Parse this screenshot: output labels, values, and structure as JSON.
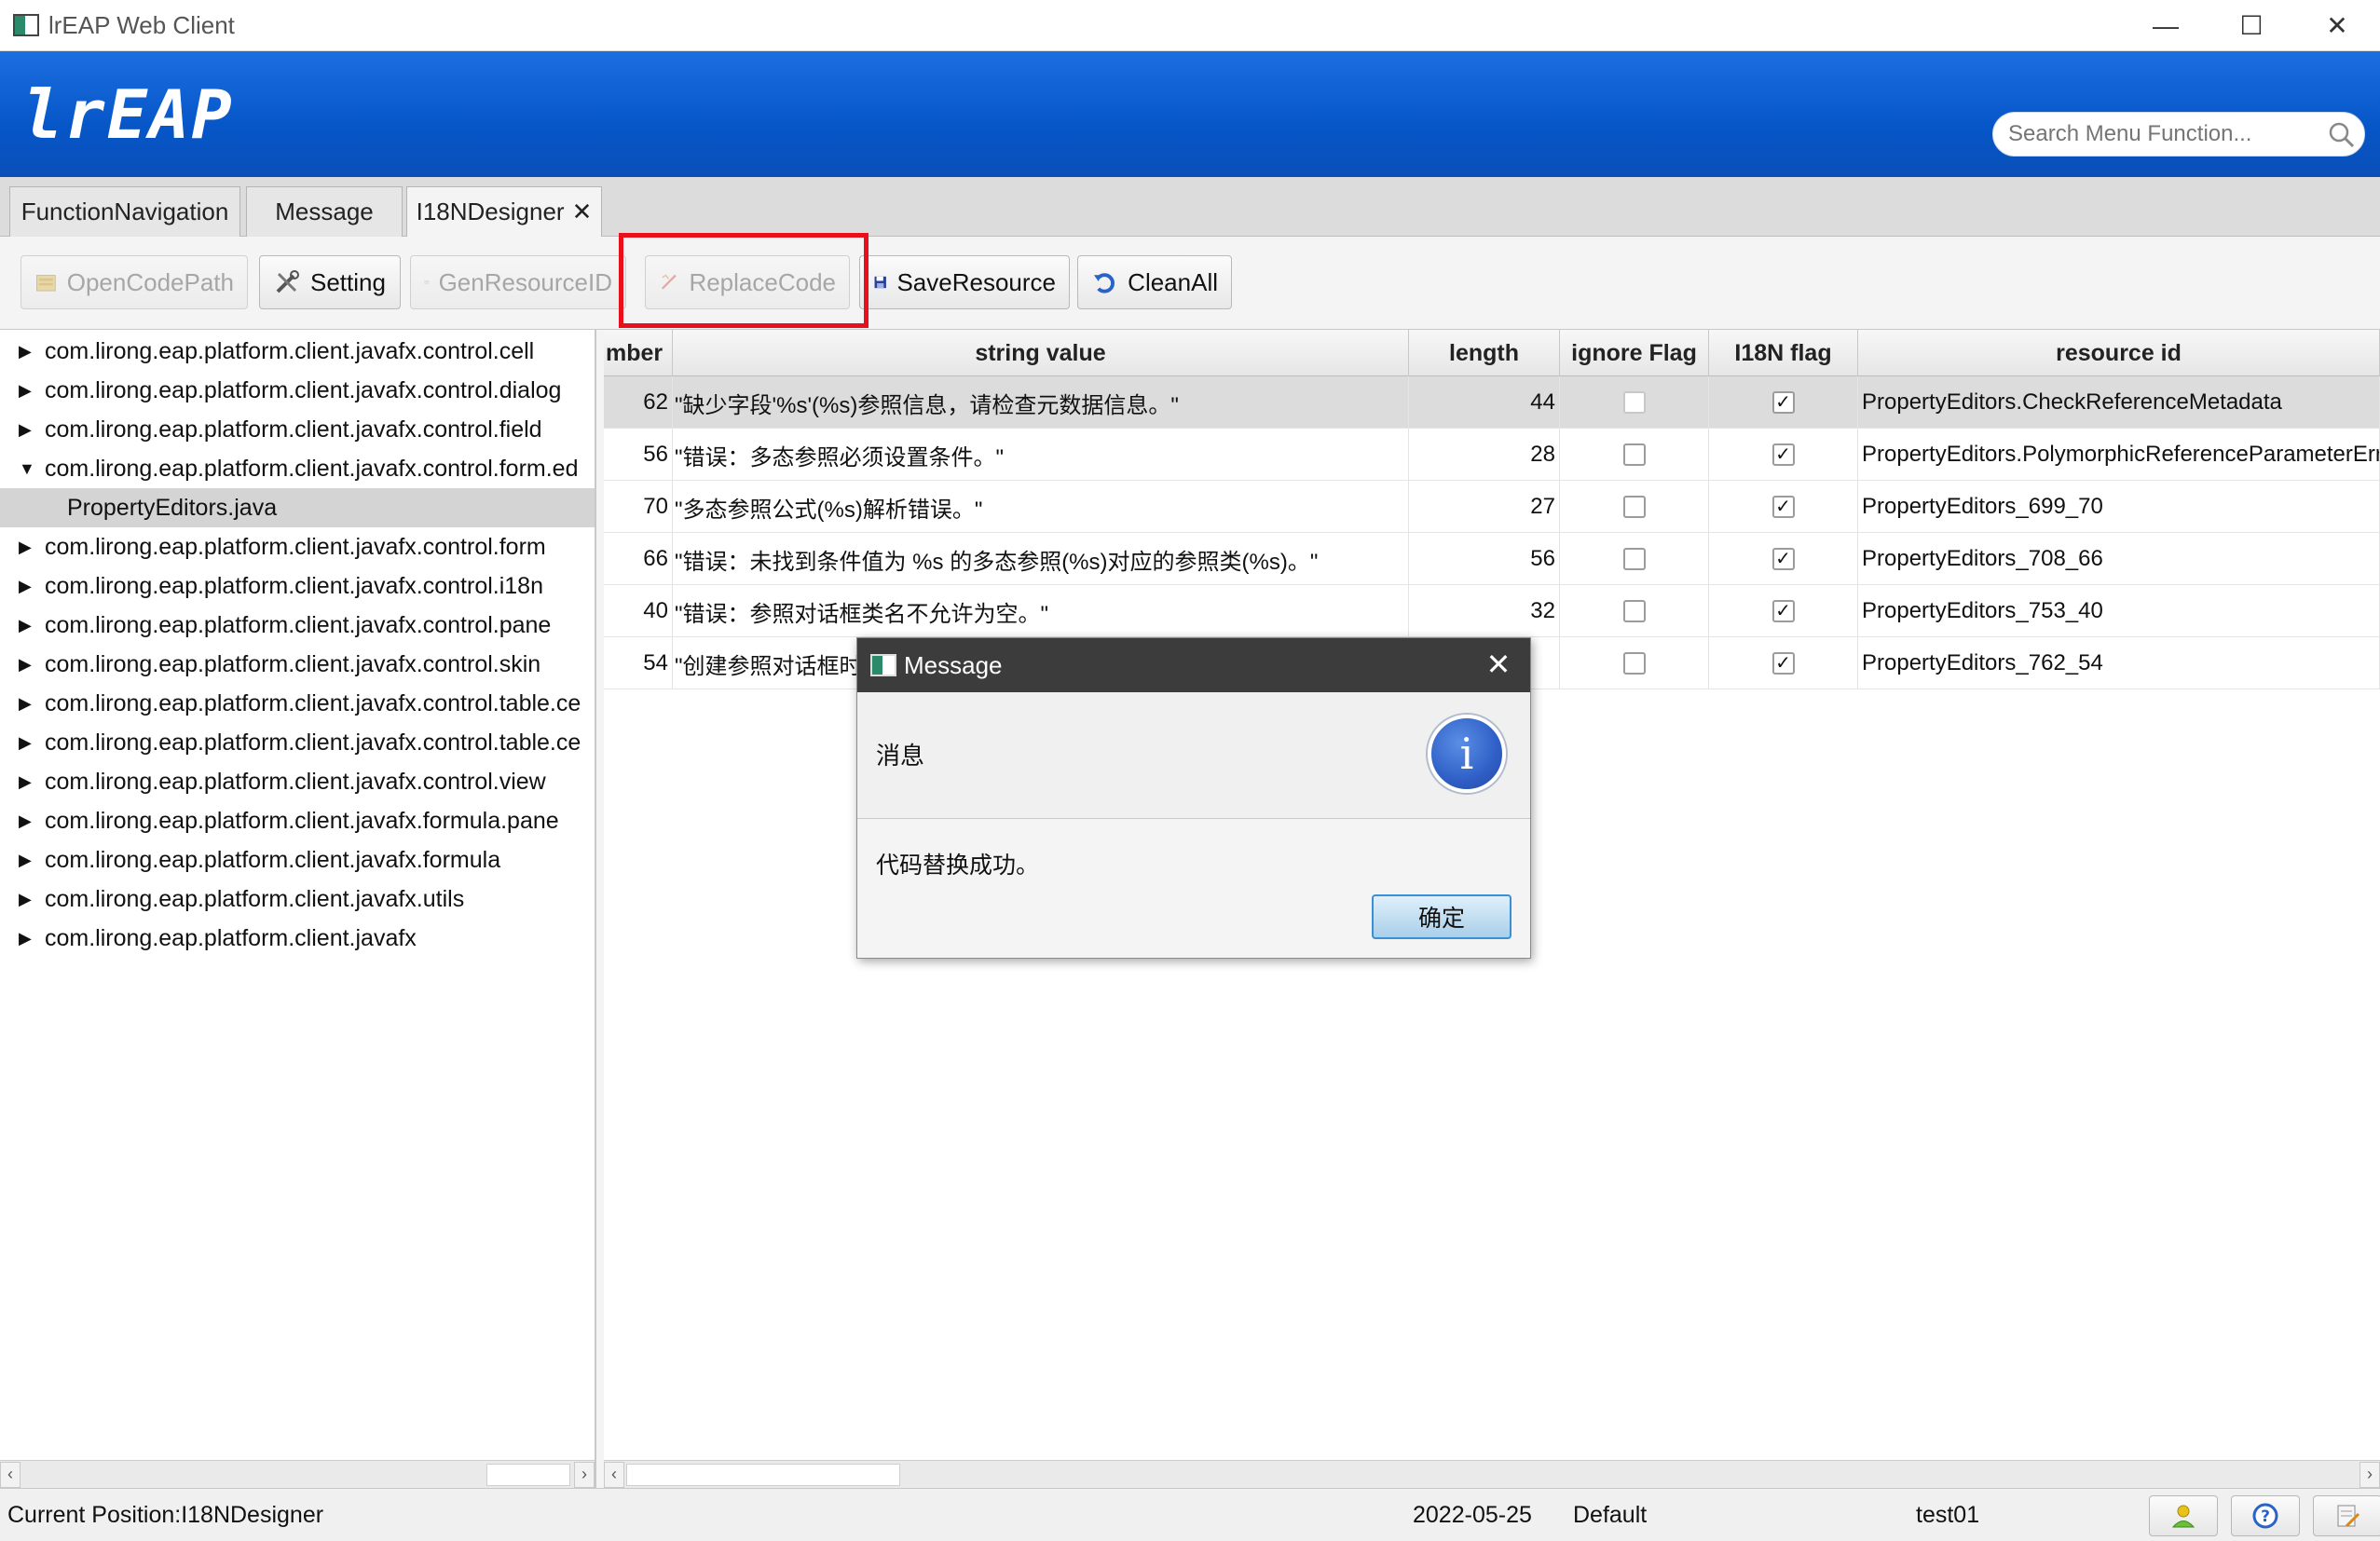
{
  "window": {
    "title": "lrEAP Web Client",
    "controls": [
      "—",
      "☐",
      "✕"
    ]
  },
  "banner": {
    "logo": "lrEAP",
    "search_placeholder": "Search Menu Function..."
  },
  "tabs": [
    {
      "label": "FunctionNavigation"
    },
    {
      "label": "Message"
    },
    {
      "label": "I18NDesigner",
      "closable": true
    }
  ],
  "toolbar": {
    "buttons": [
      {
        "label": "OpenCodePath",
        "enabled": false
      },
      {
        "label": "Setting",
        "enabled": true
      },
      {
        "label": "GenResourceID",
        "enabled": false
      },
      {
        "label": "ReplaceCode",
        "enabled": false,
        "highlighted": true
      },
      {
        "label": "SaveResource",
        "enabled": true
      },
      {
        "label": "CleanAll",
        "enabled": true
      }
    ]
  },
  "tree": {
    "items": [
      {
        "label": "com.lirong.eap.platform.client.javafx.control.cell",
        "expanded": false
      },
      {
        "label": "com.lirong.eap.platform.client.javafx.control.dialog",
        "expanded": false
      },
      {
        "label": "com.lirong.eap.platform.client.javafx.control.field",
        "expanded": false
      },
      {
        "label": "com.lirong.eap.platform.client.javafx.control.form.ed",
        "expanded": true
      },
      {
        "label": "PropertyEditors.java",
        "child": true,
        "selected": true
      },
      {
        "label": "com.lirong.eap.platform.client.javafx.control.form",
        "expanded": false
      },
      {
        "label": "com.lirong.eap.platform.client.javafx.control.i18n",
        "expanded": false
      },
      {
        "label": "com.lirong.eap.platform.client.javafx.control.pane",
        "expanded": false
      },
      {
        "label": "com.lirong.eap.platform.client.javafx.control.skin",
        "expanded": false
      },
      {
        "label": "com.lirong.eap.platform.client.javafx.control.table.ce",
        "expanded": false
      },
      {
        "label": "com.lirong.eap.platform.client.javafx.control.table.ce",
        "expanded": false
      },
      {
        "label": "com.lirong.eap.platform.client.javafx.control.view",
        "expanded": false
      },
      {
        "label": "com.lirong.eap.platform.client.javafx.formula.pane",
        "expanded": false
      },
      {
        "label": "com.lirong.eap.platform.client.javafx.formula",
        "expanded": false
      },
      {
        "label": "com.lirong.eap.platform.client.javafx.utils",
        "expanded": false
      },
      {
        "label": "com.lirong.eap.platform.client.javafx",
        "expanded": false
      }
    ]
  },
  "table": {
    "columns": [
      "mber",
      "string value",
      "length",
      "ignore Flag",
      "I18N flag",
      "resource id"
    ],
    "rows": [
      {
        "number": "62",
        "value": "\"缺少字段'%s'(%s)参照信息，请检查元数据信息。\"",
        "length": "44",
        "ignore": false,
        "i18n": true,
        "resource_id": "PropertyEditors.CheckReferenceMetadata",
        "selected": true
      },
      {
        "number": "56",
        "value": "\"错误：多态参照必须设置条件。\"",
        "length": "28",
        "ignore": false,
        "i18n": true,
        "resource_id": "PropertyEditors.PolymorphicReferenceParameterError"
      },
      {
        "number": "70",
        "value": "\"多态参照公式(%s)解析错误。\"",
        "length": "27",
        "ignore": false,
        "i18n": true,
        "resource_id": "PropertyEditors_699_70"
      },
      {
        "number": "66",
        "value": "\"错误：未找到条件值为 %s 的多态参照(%s)对应的参照类(%s)。\"",
        "length": "56",
        "ignore": false,
        "i18n": true,
        "resource_id": "PropertyEditors_708_66"
      },
      {
        "number": "40",
        "value": "\"错误：参照对话框类名不允许为空。\"",
        "length": "32",
        "ignore": false,
        "i18n": true,
        "resource_id": "PropertyEditors_753_40"
      },
      {
        "number": "54",
        "value": "\"创建参照对话框时",
        "length": "",
        "ignore": false,
        "i18n": true,
        "resource_id": "PropertyEditors_762_54"
      }
    ]
  },
  "dialog": {
    "title": "Message",
    "header": "消息",
    "content": "代码替换成功。",
    "ok_label": "确定",
    "close_glyph": "✕",
    "info_glyph": "i"
  },
  "statusbar": {
    "position": "Current Position:I18NDesigner",
    "date": "2022-05-25",
    "profile": "Default",
    "user": "test01"
  },
  "colors": {
    "banner": "#0656c8",
    "highlight": "#e8101a",
    "dialog_title": "#3c3c3c"
  }
}
